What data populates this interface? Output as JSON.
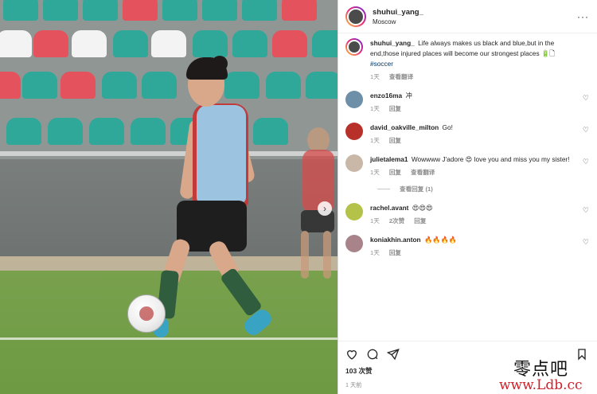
{
  "post": {
    "username": "shuhui_yang_",
    "location": "Moscow",
    "caption": "Life always makes us black and blue,but in the end,those injured places will become our strongest places",
    "caption_emoji": "🔋🗋",
    "hashtag": "#soccer",
    "caption_time": "1天",
    "see_translation": "查看翻译",
    "likes": "103 次赞",
    "posted_time": "1 天前",
    "more_icon": "more-dots-icon"
  },
  "comments": [
    {
      "user": "enzo16ma",
      "text": "冲",
      "time": "1天",
      "reply": "回复",
      "translate": ""
    },
    {
      "user": "david_oakville_milton",
      "text": "Go!",
      "time": "1天",
      "reply": "回复",
      "translate": ""
    },
    {
      "user": "julietalema1",
      "text": "Wowwww J'adore 😍 love you and miss you my sister!",
      "time": "1天",
      "reply": "回复",
      "translate": "查看翻译",
      "view_replies": "查看回复 (1)"
    },
    {
      "user": "rachel.avant",
      "text": "😍😍😍",
      "time": "1天",
      "likes": "2次赞",
      "reply": "回复",
      "translate": ""
    },
    {
      "user": "koniakhin.anton",
      "text": "🔥🔥🔥🔥",
      "time": "1天",
      "reply": "回复",
      "translate": ""
    }
  ],
  "watermark": {
    "cn": "零点吧",
    "url": "www.Ldb.cc"
  },
  "colors": {
    "accent_link": "#00376b",
    "muted": "#8e8e8e",
    "text": "#262626"
  }
}
